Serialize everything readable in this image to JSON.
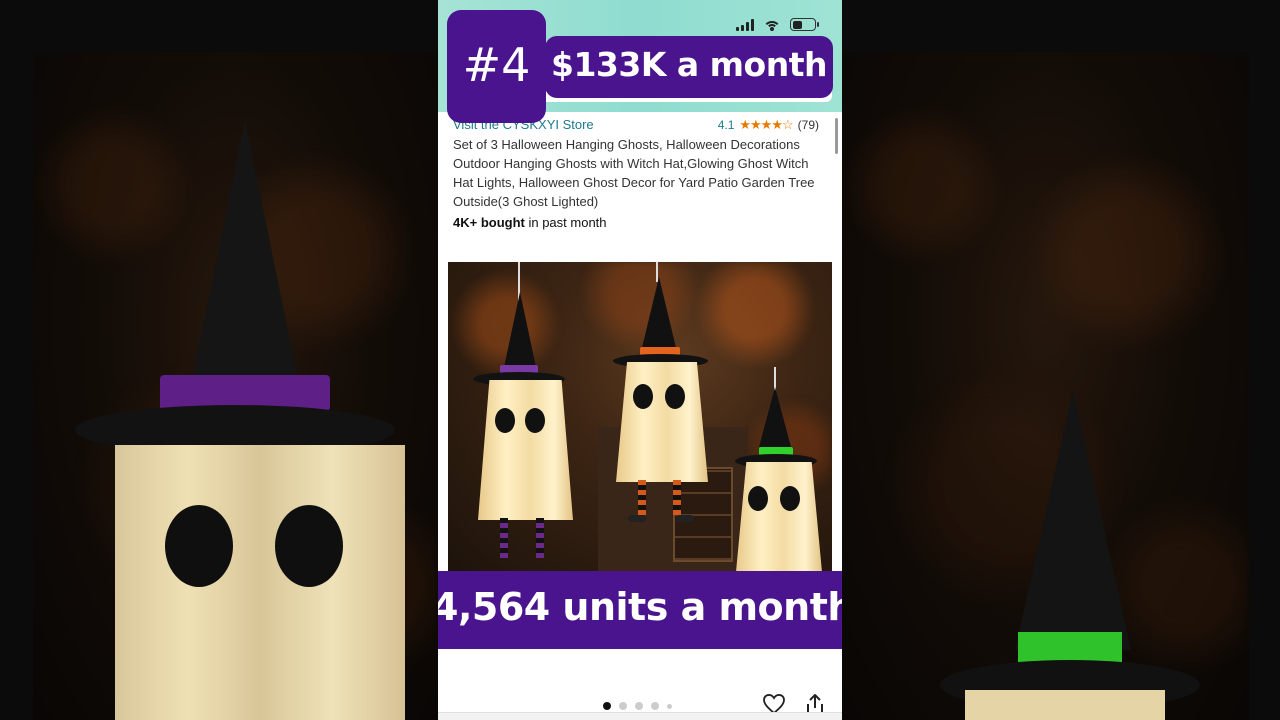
{
  "overlay": {
    "rank": "#4",
    "revenue": "$133K a month",
    "units": "4,564 units a month"
  },
  "listing": {
    "store_link": "Visit the CYSKXYI Store",
    "rating_value": "4.1",
    "stars_icon": "★★★★☆",
    "review_count": "(79)",
    "title": "Set of 3 Halloween Hanging Ghosts, Halloween Decorations Outdoor Hanging Ghosts with Witch Hat,Glowing Ghost Witch Hat Lights, Halloween Ghost Decor for Yard Patio Garden Tree Outside(3 Ghost Lighted)",
    "bought_bold": "4K+ bought",
    "bought_rest": " in past month"
  },
  "carousel": {
    "total_dots": 5,
    "active_index": 0
  },
  "colors": {
    "overlay_purple": "#4b148f",
    "header_teal": "#8fdcd0",
    "link_teal": "#1c7a8c",
    "star_orange": "#e67a00"
  },
  "icons": {
    "heart": "heart-icon",
    "share": "share-icon",
    "signal": "cellular-signal-icon",
    "wifi": "wifi-icon",
    "battery": "battery-icon"
  }
}
